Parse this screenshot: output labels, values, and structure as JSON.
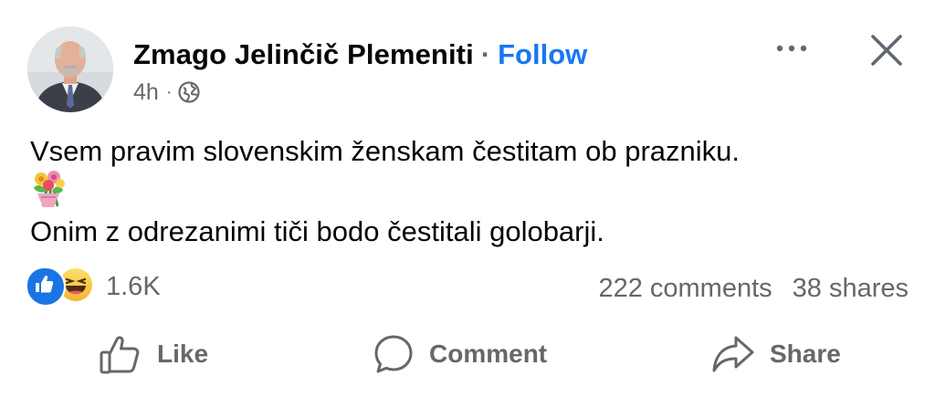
{
  "post": {
    "author": "Zmago Jelinčič Plemeniti",
    "separator": "·",
    "follow_label": "Follow",
    "time": "4h",
    "meta_separator": "·",
    "privacy_icon": "globe-icon",
    "text_line_1": "Vsem pravim slovenskim ženskam čestitam ob prazniku.",
    "emoji": "bouquet-emoji",
    "text_line_2": "Onim z odrezanimi tiči bodo čestitali golobarji."
  },
  "engagement": {
    "reaction_icons": [
      "like-reaction-icon",
      "haha-reaction-icon"
    ],
    "reaction_count": "1.6K",
    "comments": "222 comments",
    "shares": "38 shares"
  },
  "actions": {
    "like_label": "Like",
    "comment_label": "Comment",
    "share_label": "Share"
  },
  "colors": {
    "link_blue": "#1877f2",
    "secondary_text": "#65676b",
    "like_blue": "#1b74e4"
  }
}
